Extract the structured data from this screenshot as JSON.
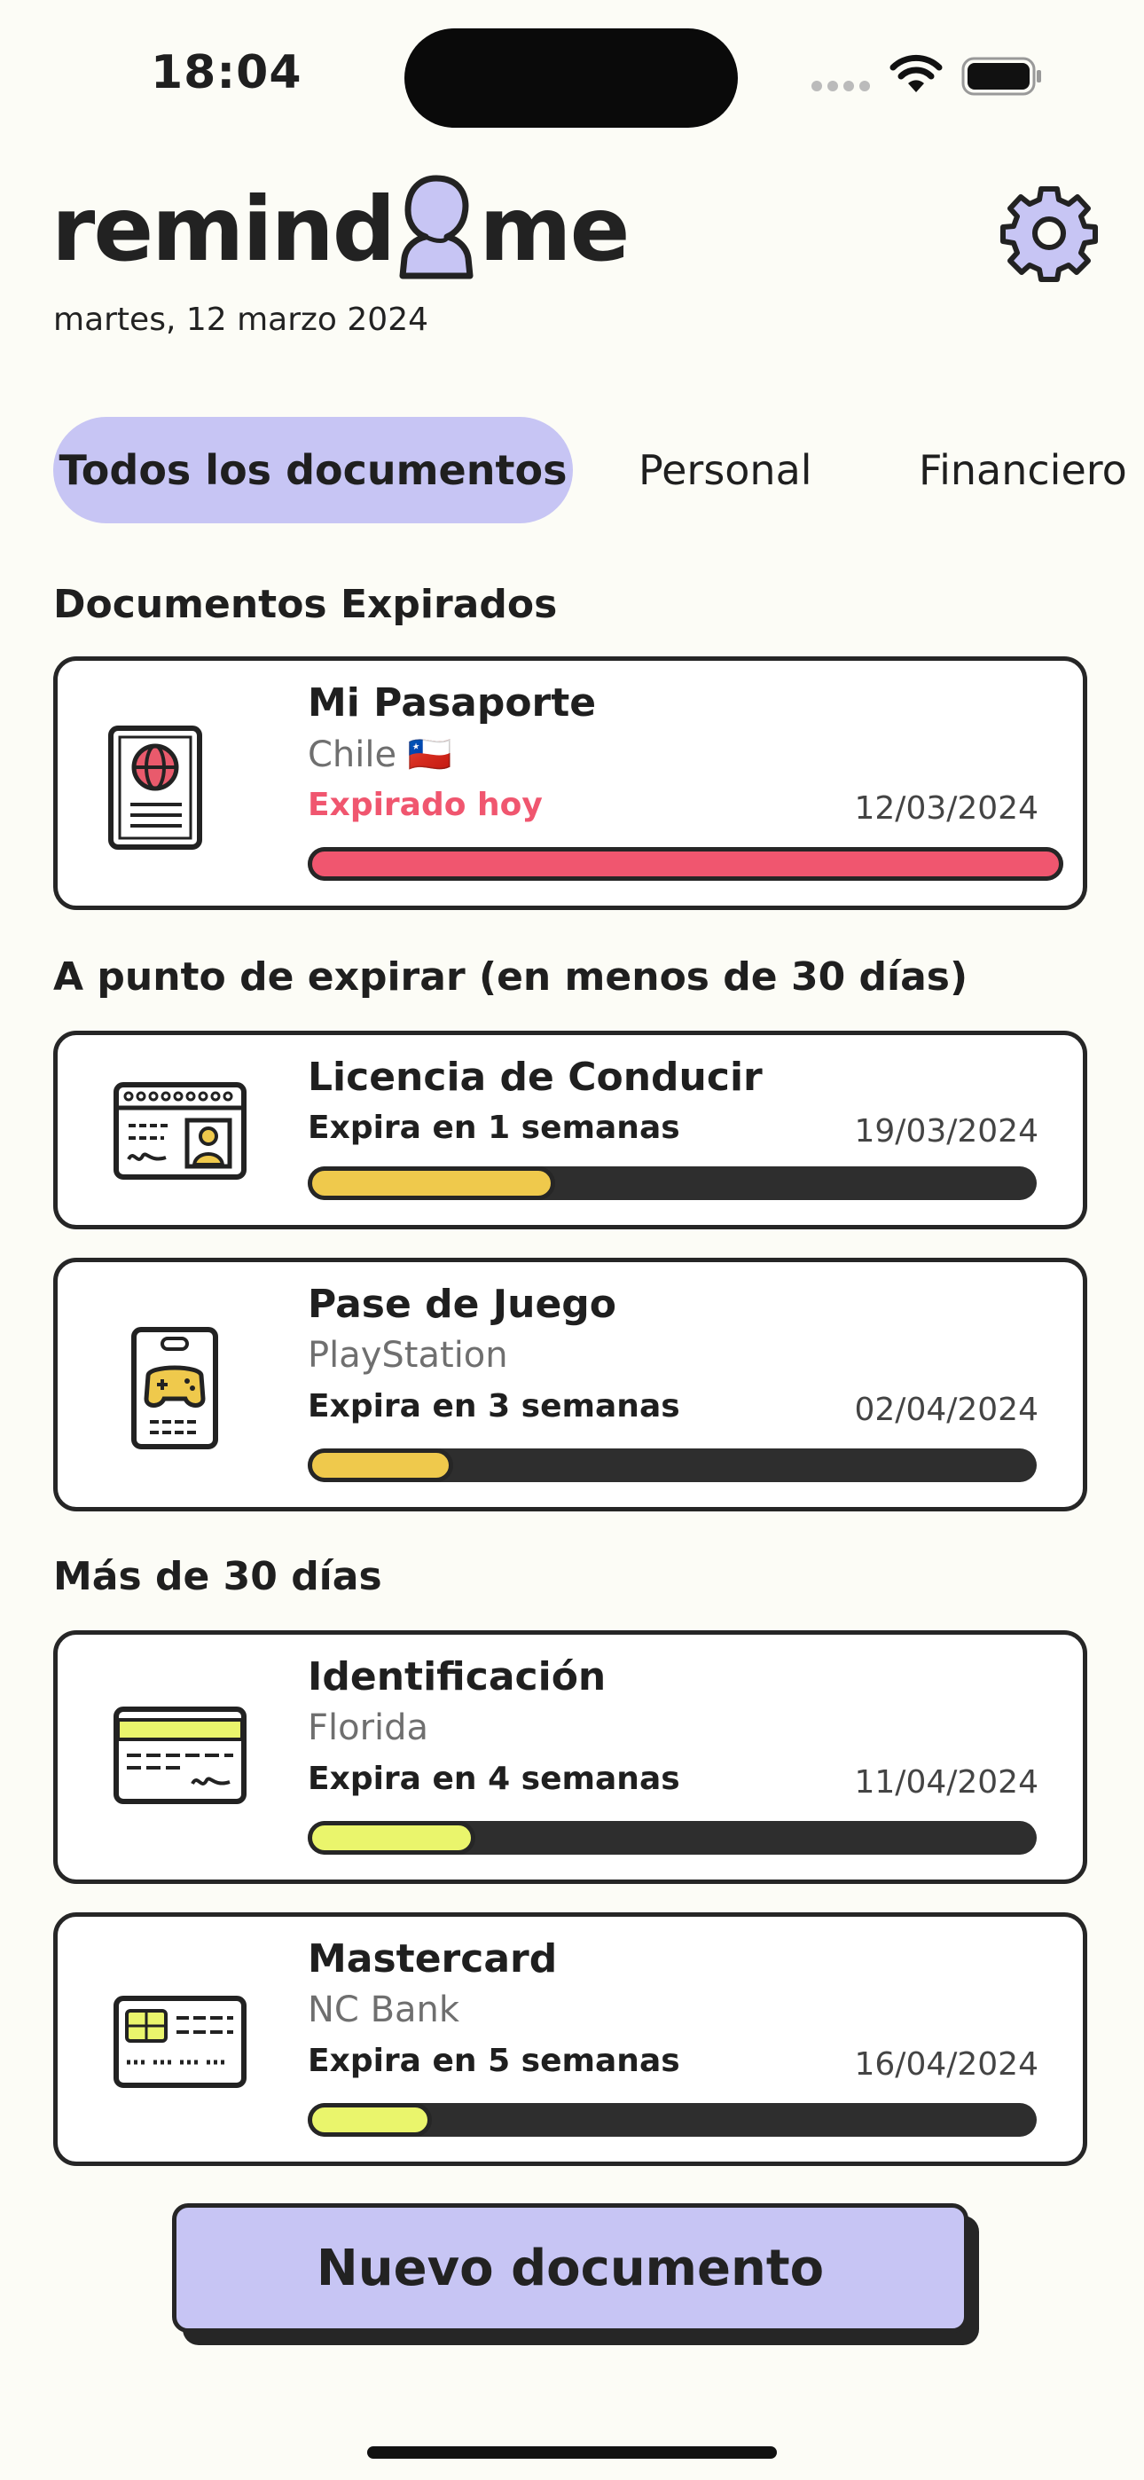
{
  "status_bar": {
    "time": "18:04"
  },
  "header": {
    "logo_left": "remind",
    "logo_right": "me",
    "date": "martes, 12 marzo 2024"
  },
  "tabs": [
    {
      "label": "Todos los documentos",
      "active": true
    },
    {
      "label": "Personal",
      "active": false
    },
    {
      "label": "Financiero",
      "active": false
    }
  ],
  "sections": {
    "expired": "Documentos Expirados",
    "soon": "A punto de expirar (en menos de 30 días)",
    "later": "Más de 30 días"
  },
  "documents": [
    {
      "title": "Mi Pasaporte",
      "subtitle": "Chile 🇨🇱",
      "status": "Expirado hoy",
      "date": "12/03/2024",
      "progress": 1.0,
      "bar_color": "#f0566f",
      "status_color": "#f0566f",
      "icon": "passport-icon"
    },
    {
      "title": "Licencia de Conducir",
      "subtitle": "",
      "status": "Expira en 1 semanas",
      "date": "19/03/2024",
      "progress": 0.34,
      "bar_color": "#efc94c",
      "status_color": "#222222",
      "icon": "driver-license-icon"
    },
    {
      "title": "Pase de Juego",
      "subtitle": "PlayStation",
      "status": "Expira en 3 semanas",
      "date": "02/04/2024",
      "progress": 0.2,
      "bar_color": "#efc94c",
      "status_color": "#222222",
      "icon": "game-pass-icon"
    },
    {
      "title": "Identificación",
      "subtitle": "Florida",
      "status": "Expira en 4 semanas",
      "date": "11/04/2024",
      "progress": 0.23,
      "bar_color": "#eaf56c",
      "status_color": "#222222",
      "icon": "id-card-icon"
    },
    {
      "title": "Mastercard",
      "subtitle": "NC Bank",
      "status": "Expira en 5 semanas",
      "date": "16/04/2024",
      "progress": 0.17,
      "bar_color": "#eaf56c",
      "status_color": "#222222",
      "icon": "credit-card-icon"
    }
  ],
  "new_button": "Nuevo documento",
  "colors": {
    "accent": "#c7c5f4",
    "background": "#fcfcf6",
    "danger": "#f0566f"
  }
}
